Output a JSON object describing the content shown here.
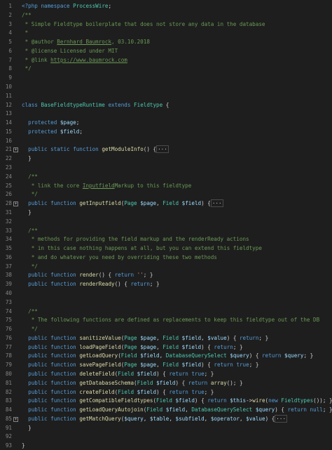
{
  "editor": {
    "lines": [
      {
        "n": "1",
        "fold": "",
        "tokens": [
          [
            "tag",
            "<?php"
          ],
          [
            "punc",
            " "
          ],
          [
            "kw",
            "namespace"
          ],
          [
            "punc",
            " "
          ],
          [
            "cls",
            "ProcessWire"
          ],
          [
            "punc",
            ";"
          ]
        ]
      },
      {
        "n": "2",
        "fold": "",
        "tokens": [
          [
            "com",
            "/**"
          ]
        ]
      },
      {
        "n": "3",
        "fold": "",
        "tokens": [
          [
            "com",
            " * Simple Fieldtype boilerplate that does not store any data in the database"
          ]
        ]
      },
      {
        "n": "4",
        "fold": "",
        "tokens": [
          [
            "com",
            " *"
          ]
        ]
      },
      {
        "n": "5",
        "fold": "",
        "tokens": [
          [
            "com",
            " * @author "
          ],
          [
            "link",
            "Bernhard Baumrock"
          ],
          [
            "com",
            ", 03.10.2018"
          ]
        ]
      },
      {
        "n": "6",
        "fold": "",
        "tokens": [
          [
            "com",
            " * @license Licensed under MIT"
          ]
        ]
      },
      {
        "n": "7",
        "fold": "",
        "tokens": [
          [
            "com",
            " * @link "
          ],
          [
            "link",
            "https://www.baumrock.com"
          ]
        ]
      },
      {
        "n": "8",
        "fold": "",
        "tokens": [
          [
            "com",
            " */"
          ]
        ]
      },
      {
        "n": "9",
        "fold": "",
        "tokens": []
      },
      {
        "n": "10",
        "fold": "",
        "tokens": []
      },
      {
        "n": "11",
        "fold": "",
        "tokens": []
      },
      {
        "n": "12",
        "fold": "",
        "tokens": [
          [
            "kw",
            "class"
          ],
          [
            "punc",
            " "
          ],
          [
            "cls",
            "BaseFieldtypeRuntime"
          ],
          [
            "punc",
            " "
          ],
          [
            "kw",
            "extends"
          ],
          [
            "punc",
            " "
          ],
          [
            "cls",
            "Fieldtype"
          ],
          [
            "punc",
            " {"
          ]
        ]
      },
      {
        "n": "13",
        "fold": "",
        "tokens": []
      },
      {
        "n": "14",
        "fold": "",
        "tokens": [
          [
            "punc",
            "  "
          ],
          [
            "kw",
            "protected"
          ],
          [
            "punc",
            " "
          ],
          [
            "var",
            "$page"
          ],
          [
            "punc",
            ";"
          ]
        ]
      },
      {
        "n": "15",
        "fold": "",
        "tokens": [
          [
            "punc",
            "  "
          ],
          [
            "kw",
            "protected"
          ],
          [
            "punc",
            " "
          ],
          [
            "var",
            "$field"
          ],
          [
            "punc",
            ";"
          ]
        ]
      },
      {
        "n": "16",
        "fold": "",
        "tokens": []
      },
      {
        "n": "21",
        "fold": "+",
        "tokens": [
          [
            "punc",
            "  "
          ],
          [
            "kw",
            "public static function"
          ],
          [
            "punc",
            " "
          ],
          [
            "fn",
            "getModuleInfo"
          ],
          [
            "punc",
            "() {"
          ],
          [
            "fold",
            "···"
          ]
        ]
      },
      {
        "n": "22",
        "fold": "",
        "tokens": [
          [
            "punc",
            "  }"
          ]
        ]
      },
      {
        "n": "23",
        "fold": "",
        "tokens": []
      },
      {
        "n": "24",
        "fold": "",
        "tokens": [
          [
            "com",
            "  /**"
          ]
        ]
      },
      {
        "n": "25",
        "fold": "",
        "tokens": [
          [
            "com",
            "   * link the core "
          ],
          [
            "link",
            "Inputfield"
          ],
          [
            "com",
            "Markup to this fieldtype"
          ]
        ]
      },
      {
        "n": "26",
        "fold": "",
        "tokens": [
          [
            "com",
            "   */"
          ]
        ]
      },
      {
        "n": "28",
        "fold": "+",
        "tokens": [
          [
            "punc",
            "  "
          ],
          [
            "kw",
            "public function"
          ],
          [
            "punc",
            " "
          ],
          [
            "fn",
            "getInputfield"
          ],
          [
            "punc",
            "("
          ],
          [
            "cls",
            "Page"
          ],
          [
            "punc",
            " "
          ],
          [
            "var",
            "$page"
          ],
          [
            "punc",
            ", "
          ],
          [
            "cls",
            "Field"
          ],
          [
            "punc",
            " "
          ],
          [
            "var",
            "$field"
          ],
          [
            "punc",
            ") {"
          ],
          [
            "fold",
            "···"
          ]
        ]
      },
      {
        "n": "31",
        "fold": "",
        "tokens": [
          [
            "punc",
            "  }"
          ]
        ]
      },
      {
        "n": "32",
        "fold": "",
        "tokens": []
      },
      {
        "n": "33",
        "fold": "",
        "tokens": [
          [
            "com",
            "  /**"
          ]
        ]
      },
      {
        "n": "34",
        "fold": "",
        "tokens": [
          [
            "com",
            "   * methods for providing the field markup and the renderReady actions"
          ]
        ]
      },
      {
        "n": "35",
        "fold": "",
        "tokens": [
          [
            "com",
            "   * in this case nothing happens at all, but you can extend this fieldtype"
          ]
        ]
      },
      {
        "n": "36",
        "fold": "",
        "tokens": [
          [
            "com",
            "   * and do whatever you need by overriding these two methods"
          ]
        ]
      },
      {
        "n": "37",
        "fold": "",
        "tokens": [
          [
            "com",
            "   */"
          ]
        ]
      },
      {
        "n": "38",
        "fold": "",
        "tokens": [
          [
            "punc",
            "  "
          ],
          [
            "kw",
            "public function"
          ],
          [
            "punc",
            " "
          ],
          [
            "fn",
            "render"
          ],
          [
            "punc",
            "() { "
          ],
          [
            "kw",
            "return"
          ],
          [
            "punc",
            " "
          ],
          [
            "str",
            "''"
          ],
          [
            "punc",
            "; }"
          ]
        ]
      },
      {
        "n": "39",
        "fold": "",
        "tokens": [
          [
            "punc",
            "  "
          ],
          [
            "kw",
            "public function"
          ],
          [
            "punc",
            " "
          ],
          [
            "fn",
            "renderReady"
          ],
          [
            "punc",
            "() { "
          ],
          [
            "kw",
            "return"
          ],
          [
            "punc",
            "; }"
          ]
        ]
      },
      {
        "n": "40",
        "fold": "",
        "tokens": []
      },
      {
        "n": "73",
        "fold": "",
        "tokens": []
      },
      {
        "n": "74",
        "fold": "",
        "tokens": [
          [
            "com",
            "  /**"
          ]
        ]
      },
      {
        "n": "75",
        "fold": "",
        "tokens": [
          [
            "com",
            "   * The following functions are defined as replacements to keep this fieldtype out of the DB"
          ]
        ]
      },
      {
        "n": "76",
        "fold": "",
        "tokens": [
          [
            "com",
            "   */"
          ]
        ]
      },
      {
        "n": "76",
        "fold": "",
        "tokens": [
          [
            "punc",
            "  "
          ],
          [
            "kw",
            "public function"
          ],
          [
            "punc",
            " "
          ],
          [
            "fn",
            "sanitizeValue"
          ],
          [
            "punc",
            "("
          ],
          [
            "cls",
            "Page"
          ],
          [
            "punc",
            " "
          ],
          [
            "var",
            "$page"
          ],
          [
            "punc",
            ", "
          ],
          [
            "cls",
            "Field"
          ],
          [
            "punc",
            " "
          ],
          [
            "var",
            "$field"
          ],
          [
            "punc",
            ", "
          ],
          [
            "var",
            "$value"
          ],
          [
            "punc",
            ") { "
          ],
          [
            "kw",
            "return"
          ],
          [
            "punc",
            "; }"
          ]
        ]
      },
      {
        "n": "77",
        "fold": "",
        "tokens": [
          [
            "punc",
            "  "
          ],
          [
            "kw",
            "public function"
          ],
          [
            "punc",
            " "
          ],
          [
            "fn",
            "loadPageField"
          ],
          [
            "punc",
            "("
          ],
          [
            "cls",
            "Page"
          ],
          [
            "punc",
            " "
          ],
          [
            "var",
            "$page"
          ],
          [
            "punc",
            ", "
          ],
          [
            "cls",
            "Field"
          ],
          [
            "punc",
            " "
          ],
          [
            "var",
            "$field"
          ],
          [
            "punc",
            ") { "
          ],
          [
            "kw",
            "return"
          ],
          [
            "punc",
            "; }"
          ]
        ]
      },
      {
        "n": "78",
        "fold": "",
        "tokens": [
          [
            "punc",
            "  "
          ],
          [
            "kw",
            "public function"
          ],
          [
            "punc",
            " "
          ],
          [
            "fn",
            "getLoadQuery"
          ],
          [
            "punc",
            "("
          ],
          [
            "cls",
            "Field"
          ],
          [
            "punc",
            " "
          ],
          [
            "var",
            "$field"
          ],
          [
            "punc",
            ", "
          ],
          [
            "cls",
            "DatabaseQuerySelect"
          ],
          [
            "punc",
            " "
          ],
          [
            "var",
            "$query"
          ],
          [
            "punc",
            ") { "
          ],
          [
            "kw",
            "return"
          ],
          [
            "punc",
            " "
          ],
          [
            "var",
            "$query"
          ],
          [
            "punc",
            "; }"
          ]
        ]
      },
      {
        "n": "79",
        "fold": "",
        "tokens": [
          [
            "punc",
            "  "
          ],
          [
            "kw",
            "public function"
          ],
          [
            "punc",
            " "
          ],
          [
            "fn",
            "savePageField"
          ],
          [
            "punc",
            "("
          ],
          [
            "cls",
            "Page"
          ],
          [
            "punc",
            " "
          ],
          [
            "var",
            "$page"
          ],
          [
            "punc",
            ", "
          ],
          [
            "cls",
            "Field"
          ],
          [
            "punc",
            " "
          ],
          [
            "var",
            "$field"
          ],
          [
            "punc",
            ") { "
          ],
          [
            "kw",
            "return true"
          ],
          [
            "punc",
            "; }"
          ]
        ]
      },
      {
        "n": "80",
        "fold": "",
        "tokens": [
          [
            "punc",
            "  "
          ],
          [
            "kw",
            "public function"
          ],
          [
            "punc",
            " "
          ],
          [
            "fn",
            "deleteField"
          ],
          [
            "punc",
            "("
          ],
          [
            "cls",
            "Field"
          ],
          [
            "punc",
            " "
          ],
          [
            "var",
            "$field"
          ],
          [
            "punc",
            ") { "
          ],
          [
            "kw",
            "return true"
          ],
          [
            "punc",
            "; }"
          ]
        ]
      },
      {
        "n": "81",
        "fold": "",
        "tokens": [
          [
            "punc",
            "  "
          ],
          [
            "kw",
            "public function"
          ],
          [
            "punc",
            " "
          ],
          [
            "fn",
            "getDatabaseSchema"
          ],
          [
            "punc",
            "("
          ],
          [
            "cls",
            "Field"
          ],
          [
            "punc",
            " "
          ],
          [
            "var",
            "$field"
          ],
          [
            "punc",
            ") { "
          ],
          [
            "kw",
            "return"
          ],
          [
            "punc",
            " "
          ],
          [
            "fn",
            "array"
          ],
          [
            "punc",
            "(); }"
          ]
        ]
      },
      {
        "n": "82",
        "fold": "",
        "tokens": [
          [
            "punc",
            "  "
          ],
          [
            "kw",
            "public function"
          ],
          [
            "punc",
            " "
          ],
          [
            "fn",
            "createField"
          ],
          [
            "punc",
            "("
          ],
          [
            "cls",
            "Field"
          ],
          [
            "punc",
            " "
          ],
          [
            "var",
            "$field"
          ],
          [
            "punc",
            ") { "
          ],
          [
            "kw",
            "return true"
          ],
          [
            "punc",
            "; }"
          ]
        ]
      },
      {
        "n": "83",
        "fold": "",
        "tokens": [
          [
            "punc",
            "  "
          ],
          [
            "kw",
            "public function"
          ],
          [
            "punc",
            " "
          ],
          [
            "fn",
            "getCompatibleFieldtypes"
          ],
          [
            "punc",
            "("
          ],
          [
            "cls",
            "Field"
          ],
          [
            "punc",
            " "
          ],
          [
            "var",
            "$field"
          ],
          [
            "punc",
            ") { "
          ],
          [
            "kw",
            "return"
          ],
          [
            "punc",
            " "
          ],
          [
            "var",
            "$this"
          ],
          [
            "punc",
            "->"
          ],
          [
            "fn",
            "wire"
          ],
          [
            "punc",
            "("
          ],
          [
            "kw",
            "new"
          ],
          [
            "punc",
            " "
          ],
          [
            "cls",
            "Fieldtypes"
          ],
          [
            "punc",
            "()); }"
          ]
        ]
      },
      {
        "n": "84",
        "fold": "",
        "tokens": [
          [
            "punc",
            "  "
          ],
          [
            "kw",
            "public function"
          ],
          [
            "punc",
            " "
          ],
          [
            "fn",
            "getLoadQueryAutojoin"
          ],
          [
            "punc",
            "("
          ],
          [
            "cls",
            "Field"
          ],
          [
            "punc",
            " "
          ],
          [
            "var",
            "$field"
          ],
          [
            "punc",
            ", "
          ],
          [
            "cls",
            "DatabaseQuerySelect"
          ],
          [
            "punc",
            " "
          ],
          [
            "var",
            "$query"
          ],
          [
            "punc",
            ") { "
          ],
          [
            "kw",
            "return null"
          ],
          [
            "punc",
            "; }"
          ]
        ]
      },
      {
        "n": "85",
        "fold": "+",
        "tokens": [
          [
            "punc",
            "  "
          ],
          [
            "kw",
            "public function"
          ],
          [
            "punc",
            " "
          ],
          [
            "fn",
            "getMatchQuery"
          ],
          [
            "punc",
            "("
          ],
          [
            "var",
            "$query"
          ],
          [
            "punc",
            ", "
          ],
          [
            "var",
            "$table"
          ],
          [
            "punc",
            ", "
          ],
          [
            "var",
            "$subfield"
          ],
          [
            "punc",
            ", "
          ],
          [
            "var",
            "$operator"
          ],
          [
            "punc",
            ", "
          ],
          [
            "var",
            "$value"
          ],
          [
            "punc",
            ") {"
          ],
          [
            "fold",
            "···"
          ]
        ]
      },
      {
        "n": "91",
        "fold": "",
        "tokens": [
          [
            "punc",
            "  }"
          ]
        ]
      },
      {
        "n": "92",
        "fold": "",
        "tokens": []
      },
      {
        "n": "93",
        "fold": "",
        "tokens": [
          [
            "punc",
            "}"
          ]
        ]
      }
    ]
  }
}
